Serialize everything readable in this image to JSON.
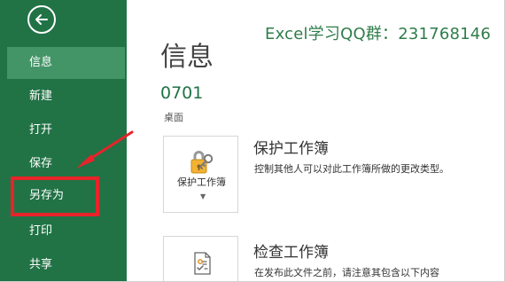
{
  "overlay": {
    "group_label": "Excel学习QQ群：231768146"
  },
  "sidebar": {
    "back_icon": "back-arrow-icon",
    "items": [
      {
        "label": "信息",
        "active": true
      },
      {
        "label": "新建"
      },
      {
        "label": "打开"
      },
      {
        "label": "保存"
      },
      {
        "label": "另存为"
      },
      {
        "label": "打印"
      },
      {
        "label": "共享"
      }
    ]
  },
  "main": {
    "title": "信息",
    "file_name": "0701",
    "file_location": "桌面",
    "sections": [
      {
        "button_label": "保护工作簿",
        "title": "保护工作簿",
        "description": "控制其他人可以对此工作簿所做的更改类型。",
        "icon": "lock-key-icon"
      },
      {
        "title": "检查工作簿",
        "description": "在发布此文件之前，请注意其包含以下内容",
        "icon": "inspect-document-icon"
      }
    ]
  },
  "annotation": {
    "highlight_color": "#e8232a"
  },
  "colors": {
    "sidebar": "#217346",
    "sidebar_active": "#439467",
    "accent_text": "#217346"
  }
}
